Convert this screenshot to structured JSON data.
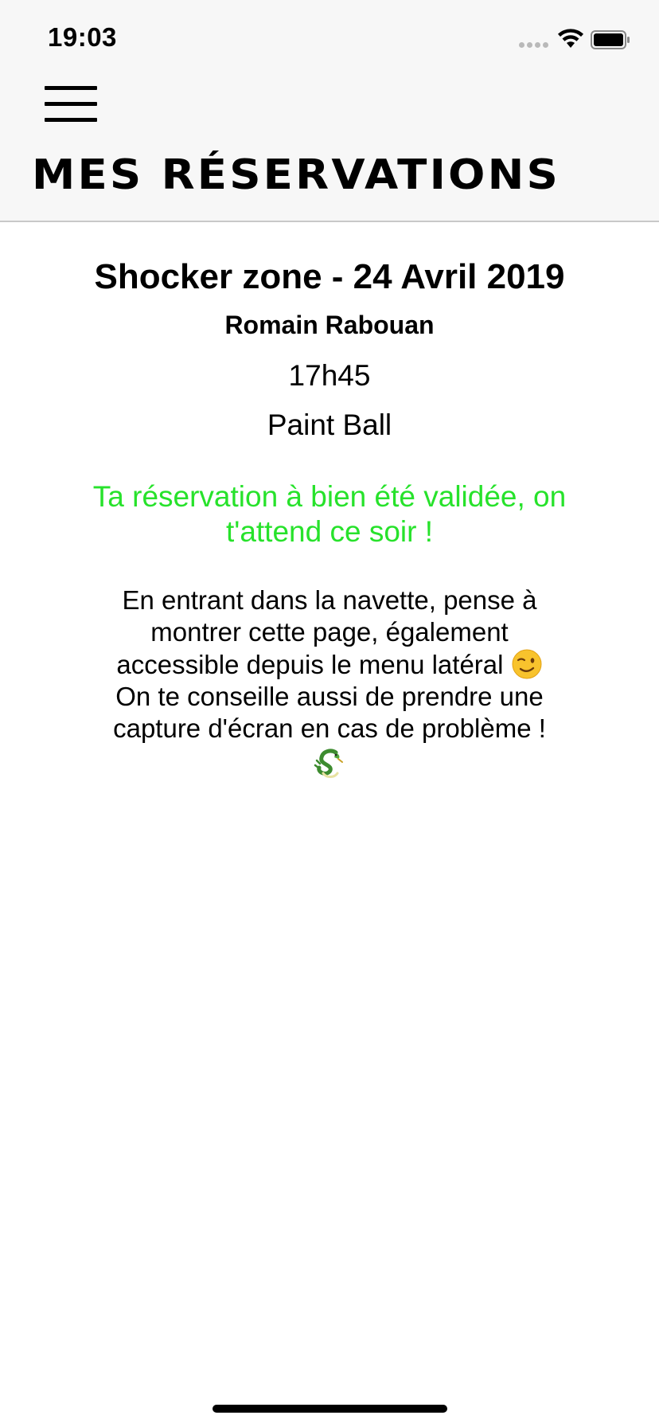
{
  "status_bar": {
    "time": "19:03",
    "signal_icon": "signal-dots-icon",
    "wifi_icon": "wifi-icon",
    "battery_icon": "battery-icon"
  },
  "header": {
    "menu_icon": "hamburger-menu-icon",
    "title": "MES RÉSERVATIONS"
  },
  "reservation": {
    "title": "Shocker zone - 24 Avril 2019",
    "name": "Romain Rabouan",
    "time": "17h45",
    "activity": "Paint Ball",
    "confirmation": "Ta réservation à bien été validée, on t'attend ce soir !",
    "info_text": "En entrant dans la navette, pense à montrer cette page, également accessible depuis le menu latéral",
    "info_text_2": "On te conseille aussi de prendre une capture d'écran en cas de problème !",
    "wink_emoji": "winking-face-icon",
    "dragon_emoji": "dragon-icon"
  },
  "colors": {
    "confirmation": "#27e22b",
    "header_bg": "#f7f7f7"
  }
}
